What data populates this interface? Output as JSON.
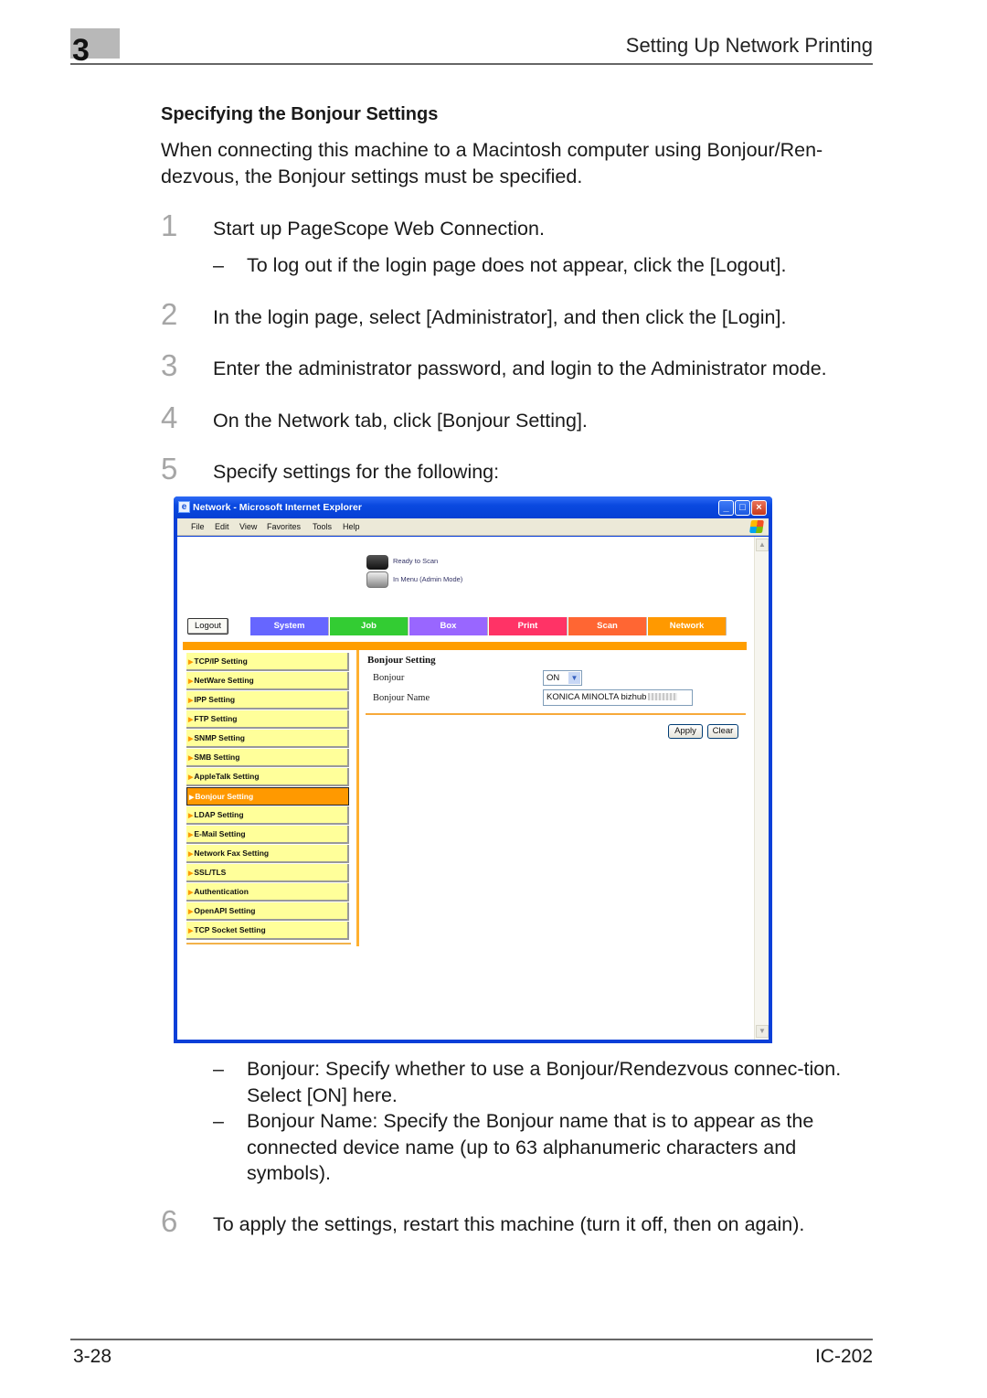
{
  "header": {
    "chapter_number": "3",
    "chapter_title": "Setting Up Network Printing"
  },
  "section": {
    "heading": "Specifying the Bonjour Settings",
    "intro": "When connecting this machine to a Macintosh computer using Bonjour/Ren-dezvous, the Bonjour settings must be specified."
  },
  "steps": [
    {
      "number": "1",
      "text": "Start up PageScope Web Connection.",
      "notes": [
        "To log out if the login page does not appear, click the [Logout]."
      ]
    },
    {
      "number": "2",
      "text": "In the login page, select [Administrator], and then click the [Login]."
    },
    {
      "number": "3",
      "text": "Enter the administrator password, and login to the Administrator mode."
    },
    {
      "number": "4",
      "text": "On the Network tab, click [Bonjour Setting]."
    },
    {
      "number": "5",
      "text": "Specify settings for the following:",
      "notes": [
        "Bonjour: Specify whether to use a Bonjour/Rendezvous connec-tion. Select [ON] here.",
        "Bonjour Name: Specify the Bonjour name that is to appear as the connected device name (up to 63 alphanumeric characters and symbols)."
      ]
    },
    {
      "number": "6",
      "text": "To apply the settings, restart this machine (turn it off, then on again)."
    }
  ],
  "note_dash": "–",
  "browser": {
    "window_title": "Network - Microsoft Internet Explorer",
    "window_controls": {
      "minimize": "_",
      "maximize": "□",
      "close": "×"
    },
    "menu": [
      "File",
      "Edit",
      "View",
      "Favorites",
      "Tools",
      "Help"
    ],
    "status": {
      "scanner": "Ready to Scan",
      "printer": "In Menu (Admin Mode)"
    },
    "logout_label": "Logout",
    "tabs": [
      {
        "label": "System",
        "color": "#6666ff"
      },
      {
        "label": "Job",
        "color": "#33cc33"
      },
      {
        "label": "Box",
        "color": "#9966ff"
      },
      {
        "label": "Print",
        "color": "#ff3366"
      },
      {
        "label": "Scan",
        "color": "#ff6633"
      },
      {
        "label": "Network",
        "color": "#ff9900"
      }
    ],
    "active_tab": "Network",
    "nav_arrow": "▶",
    "nav_items": [
      "TCP/IP Setting",
      "NetWare Setting",
      "IPP Setting",
      "FTP Setting",
      "SNMP Setting",
      "SMB Setting",
      "AppleTalk Setting",
      "Bonjour Setting",
      "LDAP Setting",
      "E-Mail Setting",
      "Network Fax Setting",
      "SSL/TLS",
      "Authentication",
      "OpenAPI Setting",
      "TCP Socket Setting"
    ],
    "active_nav": "Bonjour Setting",
    "panel": {
      "title": "Bonjour Setting",
      "bonjour_label": "Bonjour",
      "bonjour_value": "ON",
      "name_label": "Bonjour Name",
      "name_value": "KONICA MINOLTA bizhub",
      "apply_label": "Apply",
      "clear_label": "Clear"
    },
    "scroll_up": "▲",
    "scroll_down": "▼",
    "select_arrow": "▼"
  },
  "footer": {
    "page_number": "3-28",
    "model": "IC-202"
  }
}
